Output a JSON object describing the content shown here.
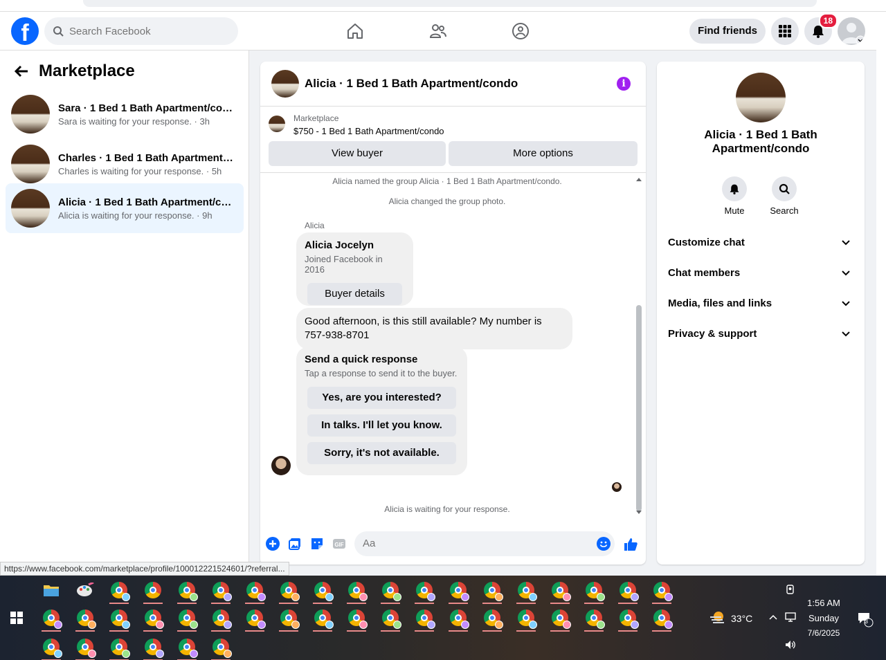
{
  "nav": {
    "search_placeholder": "Search Facebook",
    "find_friends": "Find friends",
    "notif_count": "18"
  },
  "sidebar": {
    "title": "Marketplace",
    "conversations": [
      {
        "title": "Sara · 1 Bed 1 Bath Apartment/con...",
        "subtitle": "Sara is waiting for your response. · 3h"
      },
      {
        "title": "Charles · 1 Bed 1 Bath Apartment/c...",
        "subtitle": "Charles is waiting for your response. · 5h"
      },
      {
        "title": "Alicia · 1 Bed 1 Bath Apartment/co...",
        "subtitle": "Alicia is waiting for your response. · 9h"
      }
    ]
  },
  "chat": {
    "title": "Alicia · 1 Bed 1 Bath Apartment/condo",
    "listing_label": "Marketplace",
    "listing_price": "$750 - 1 Bed 1 Bath Apartment/condo",
    "view_buyer": "View buyer",
    "more_options": "More options",
    "system_messages": [
      "Alicia named the group Alicia · 1 Bed 1 Bath Apartment/condo.",
      "Alicia changed the group photo."
    ],
    "sender": "Alicia",
    "buyer_name": "Alicia Jocelyn",
    "buyer_joined": "Joined Facebook in 2016",
    "buyer_details": "Buyer details",
    "message": "Good afternoon, is this still available? My number is 757-938-8701",
    "quick_title": "Send a quick response",
    "quick_sub": "Tap a response to send it to the buyer.",
    "quick_responses": [
      "Yes, are you interested?",
      "In talks. I'll let you know.",
      "Sorry, it's not available."
    ],
    "waiting": "Alicia is waiting for your response.",
    "composer_placeholder": "Aa"
  },
  "info_panel": {
    "name": "Alicia · 1 Bed 1 Bath Apartment/condo",
    "mute": "Mute",
    "search": "Search",
    "sections": [
      "Customize chat",
      "Chat members",
      "Media, files and links",
      "Privacy & support"
    ]
  },
  "status_url": "https://www.facebook.com/marketplace/profile/100012221524601/?referral...",
  "taskbar": {
    "temperature": "33°C",
    "time": "1:56 AM",
    "day": "Sunday",
    "date": "7/6/2025",
    "notif_count": "3"
  },
  "colors": {
    "brand": "#0866ff",
    "active_conv": "#ebf5ff",
    "info_icon": "#a020f0",
    "badge": "#e41e3f"
  }
}
